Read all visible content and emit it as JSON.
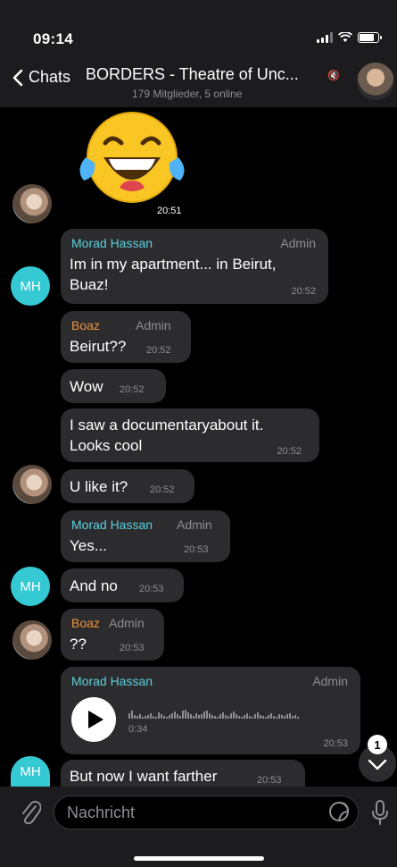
{
  "status_bar": {
    "time": "09:14"
  },
  "header": {
    "back_label": "Chats",
    "title": "BORDERS - Theatre of Unc...",
    "subtitle": "179 Mitglieder, 5 online"
  },
  "messages": [
    {
      "id": "emoji",
      "content": "😂",
      "time": "20:51"
    },
    {
      "id": "m1",
      "sender": "Morad Hassan",
      "role": "Admin",
      "lines": [
        "Im in my apartment... in Beirut,",
        "Buaz!"
      ],
      "time": "20:52"
    },
    {
      "id": "m2",
      "sender": "Boaz",
      "role": "Admin",
      "text": "Beirut??",
      "time": "20:52"
    },
    {
      "id": "m3",
      "text": "Wow",
      "time": "20:52"
    },
    {
      "id": "m4",
      "lines": [
        "I saw a documentaryabout it.",
        "Looks cool"
      ],
      "time": "20:52"
    },
    {
      "id": "m5",
      "text": "U like it?",
      "time": "20:52"
    },
    {
      "id": "m6",
      "sender": "Morad Hassan",
      "role": "Admin",
      "text": "Yes...",
      "time": "20:53"
    },
    {
      "id": "m7",
      "text": "And no",
      "time": "20:53"
    },
    {
      "id": "m8",
      "sender": "Boaz",
      "role": "Admin",
      "text": "??",
      "time": "20:53"
    },
    {
      "id": "m9",
      "sender": "Morad Hassan",
      "role": "Admin",
      "voice_duration": "0:34",
      "time": "20:53"
    },
    {
      "id": "m10",
      "text": "But now I want farther",
      "time": "20:53"
    }
  ],
  "avatars": {
    "mh_initials": "MH"
  },
  "scroll_badge": "1",
  "input": {
    "placeholder": "Nachricht"
  },
  "colors": {
    "morad_name": "#5ad1df",
    "boaz_name": "#f0923c",
    "bubble": "#2c2c2e",
    "mh_avatar": "#35c9d4"
  },
  "icons": [
    "chevron-left-icon",
    "mute-icon",
    "play-icon",
    "chevron-down-icon",
    "paperclip-icon",
    "sticker-icon",
    "microphone-icon"
  ]
}
